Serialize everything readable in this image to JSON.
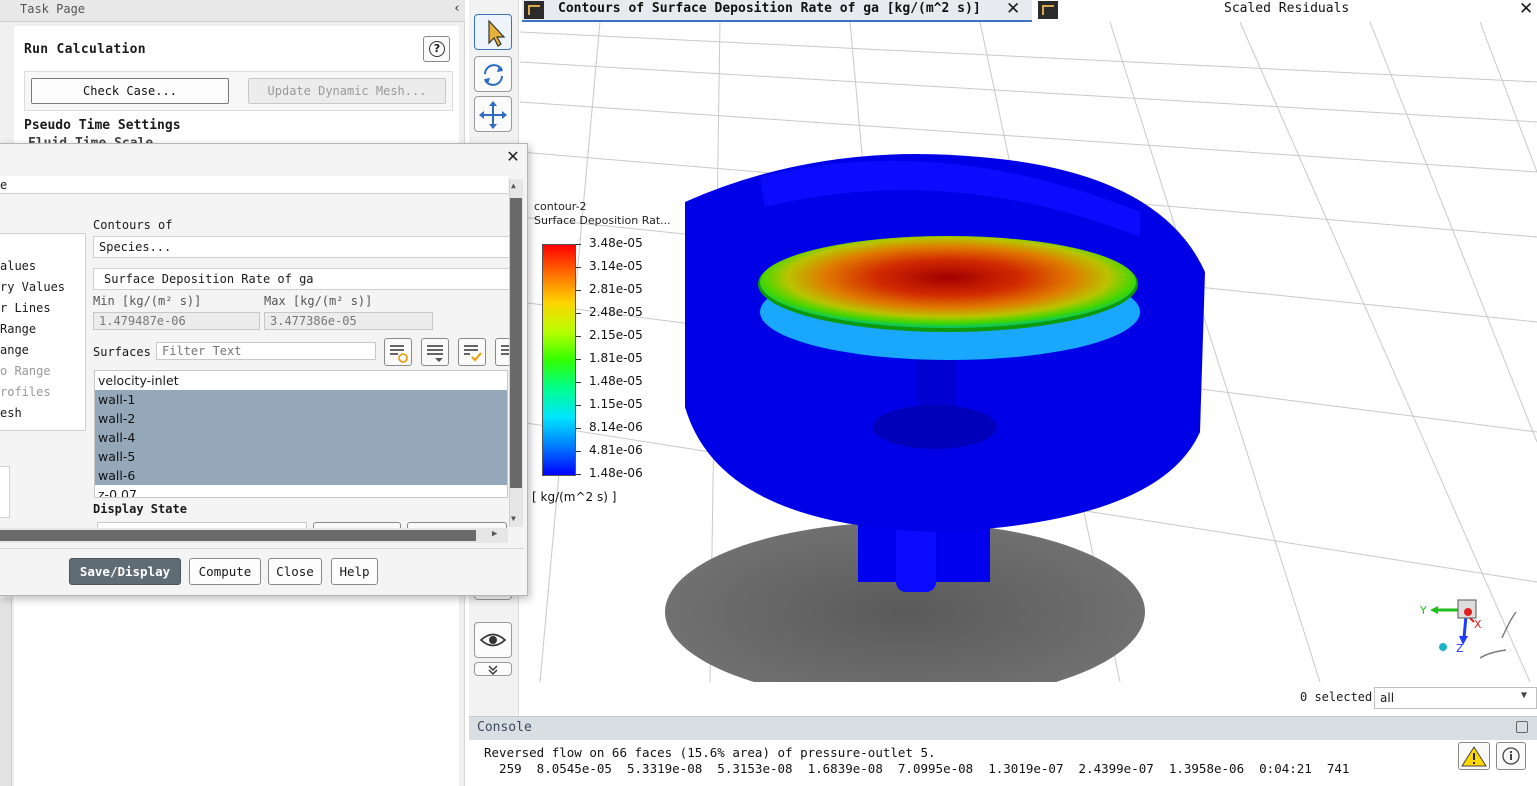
{
  "task_page": {
    "title": "Task Page",
    "run_calc_title": "Run Calculation",
    "check_case_label": "Check Case...",
    "update_mesh_label": "Update Dynamic Mesh...",
    "pseudo_time_title": "Pseudo Time Settings",
    "fluid_time_label": "Fluid Time Scale"
  },
  "dialog": {
    "name_value_partial": "e",
    "options": [
      "alues",
      "ry Values",
      "r Lines",
      " Range",
      "ange",
      "o Range",
      "rofiles",
      "esh"
    ],
    "contours_of_label": "Contours of",
    "contours_category": "Species...",
    "contours_variable": "Surface Deposition Rate of ga",
    "min_label": "Min [kg/(m² s)]",
    "max_label": "Max [kg/(m² s)]",
    "min_value": "1.479487e-06",
    "max_value": "3.477386e-05",
    "surfaces_label": "Surfaces",
    "filter_placeholder": "Filter Text",
    "surfaces": [
      {
        "name": "velocity-inlet",
        "selected": false
      },
      {
        "name": "wall-1",
        "selected": true
      },
      {
        "name": "wall-2",
        "selected": true
      },
      {
        "name": "wall-4",
        "selected": true
      },
      {
        "name": "wall-5",
        "selected": true
      },
      {
        "name": "wall-6",
        "selected": true
      },
      {
        "name": "z-0.07",
        "selected": false
      }
    ],
    "display_state_label": "Display State",
    "buttons": {
      "save_display": "Save/Display",
      "compute": "Compute",
      "close": "Close",
      "help": "Help"
    }
  },
  "graphics": {
    "tab_contours_title": "Contours of Surface Deposition Rate of ga [kg/(m^2 s)]",
    "tab_residuals_title": "Scaled Residuals",
    "legend": {
      "name": "contour-2",
      "title": "Surface Deposition Rat...",
      "labels": [
        "3.48e-05",
        "3.14e-05",
        "2.81e-05",
        "2.48e-05",
        "2.15e-05",
        "1.81e-05",
        "1.48e-05",
        "1.15e-05",
        "8.14e-06",
        "4.81e-06",
        "1.48e-06"
      ],
      "unit": "[ kg/(m^2 s) ]"
    },
    "axes": {
      "y": "Y",
      "x": "X",
      "z": "Z"
    },
    "selected_count": "0 selected",
    "select_filter": "all"
  },
  "console": {
    "title": "Console",
    "lines": [
      "Reversed flow on 66 faces (15.6% area) of pressure-outlet 5.",
      "  259  8.0545e-05  5.3319e-08  5.3153e-08  1.6839e-08  7.0995e-08  1.3019e-07  2.4399e-07  1.3958e-06  0:04:21  741"
    ]
  },
  "colors": {
    "accent": "#3a72c4",
    "selection": "#95a8ba",
    "primary_button": "#5f6b75"
  }
}
